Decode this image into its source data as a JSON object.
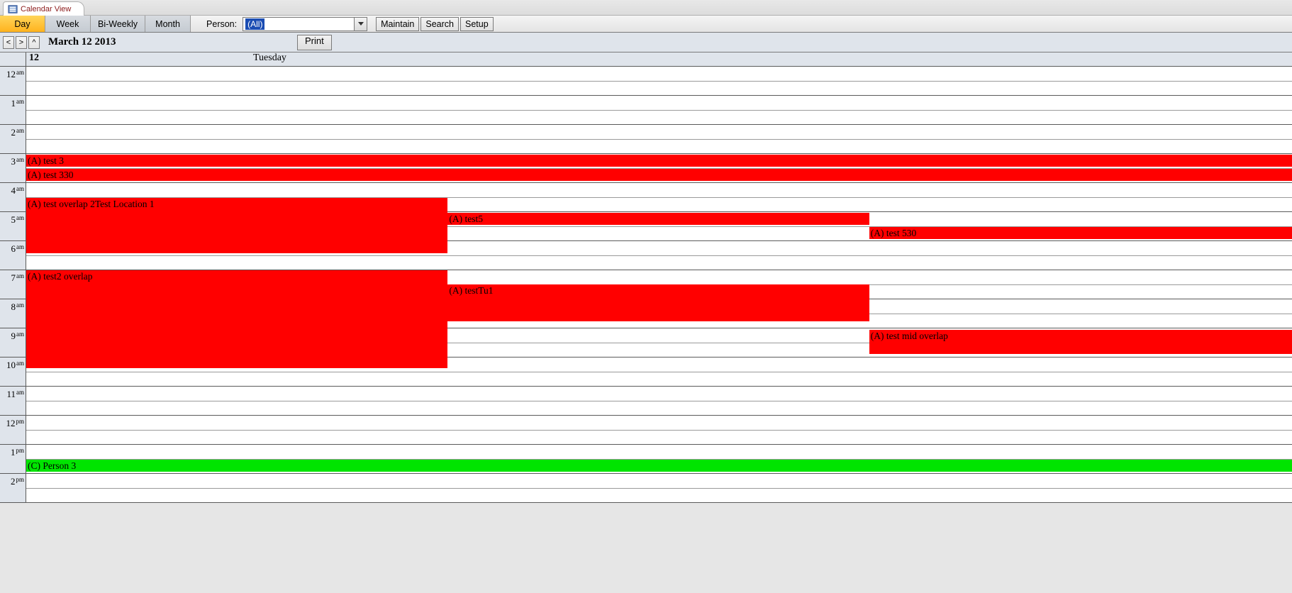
{
  "doc_tab": "Calendar View",
  "view_tabs": [
    {
      "label": "Day",
      "active": true
    },
    {
      "label": "Week",
      "active": false
    },
    {
      "label": "Bi-Weekly",
      "active": false
    },
    {
      "label": "Month",
      "active": false
    }
  ],
  "person_label": "Person:",
  "person_value": "(All)",
  "tool_buttons": {
    "maintain": "Maintain",
    "search": "Search",
    "setup": "Setup"
  },
  "nav": {
    "prev": "<",
    "next": ">",
    "up": "^"
  },
  "date_label": "March 12 2013",
  "print_label": "Print",
  "day_number": "12",
  "day_name": "Tuesday",
  "hours": [
    {
      "h": "12",
      "m": "am"
    },
    {
      "h": "1",
      "m": "am"
    },
    {
      "h": "2",
      "m": "am"
    },
    {
      "h": "3",
      "m": "am"
    },
    {
      "h": "4",
      "m": "am"
    },
    {
      "h": "5",
      "m": "am"
    },
    {
      "h": "6",
      "m": "am"
    },
    {
      "h": "7",
      "m": "am"
    },
    {
      "h": "8",
      "m": "am"
    },
    {
      "h": "9",
      "m": "am"
    },
    {
      "h": "10",
      "m": "am"
    },
    {
      "h": "11",
      "m": "am"
    },
    {
      "h": "12",
      "m": "pm"
    },
    {
      "h": "1",
      "m": "pm"
    },
    {
      "h": "2",
      "m": "pm"
    }
  ],
  "events": {
    "test3": "(A) test 3",
    "test330": "(A) test 330",
    "overlap2": "(A) test overlap 2Test Location 1",
    "test5": "(A) test5",
    "test530": "(A) test 530",
    "test2over": "(A) test2 overlap",
    "testTu1": "(A) testTu1",
    "midoverlap": "(A) test mid overlap",
    "person3": "(C) Person 3"
  }
}
